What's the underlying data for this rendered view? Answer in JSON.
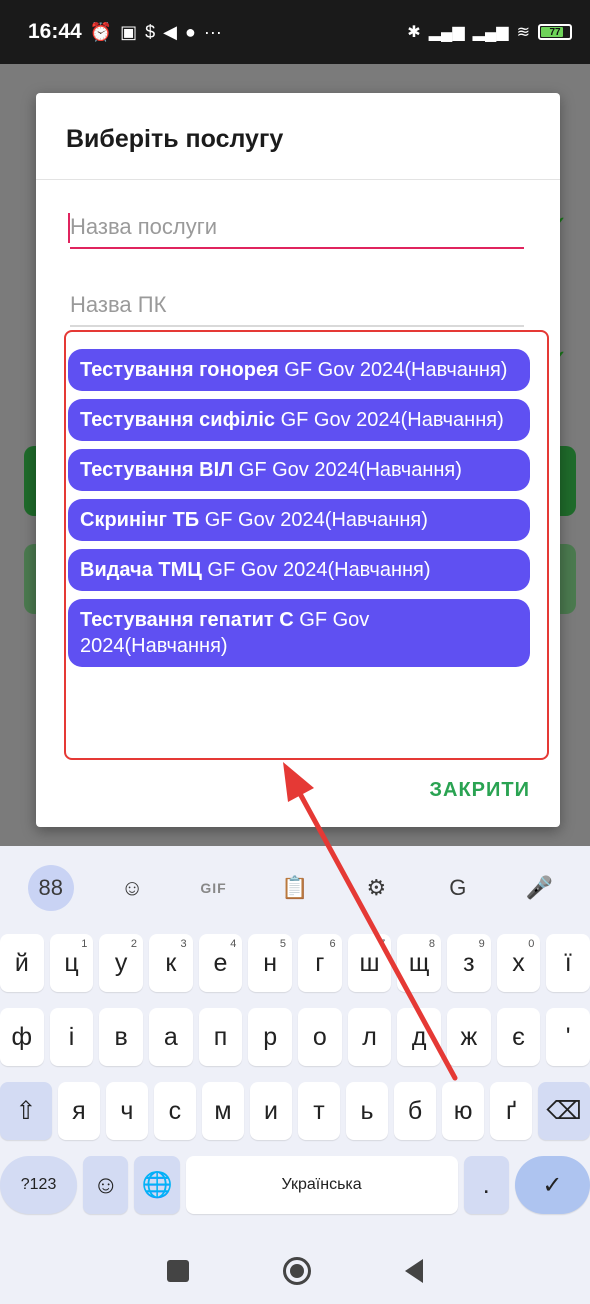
{
  "status_bar": {
    "time": "16:44",
    "left_icons": [
      "⏰",
      "▣",
      "$",
      "◀",
      "●",
      "···"
    ],
    "right_icons": [
      "✱",
      "▂▄▆",
      "▂▄▆",
      "≋"
    ],
    "battery": "77"
  },
  "dialog": {
    "title": "Виберіть послугу",
    "service_field_placeholder": "Назва послуги",
    "pc_field_placeholder": "Назва ПК",
    "services": [
      {
        "bold": "Тестування гонорея",
        "rest": " GF Gov 2024(Навчання)"
      },
      {
        "bold": "Тестування сифіліс",
        "rest": " GF Gov 2024(Навчання)"
      },
      {
        "bold": "Тестування ВІЛ",
        "rest": " GF Gov 2024(Навчання)"
      },
      {
        "bold": "Скринінг ТБ",
        "rest": " GF Gov 2024(Навчання)"
      },
      {
        "bold": "Видача ТМЦ",
        "rest": " GF Gov 2024(Навчання)"
      },
      {
        "bold": "Тестування гепатит С",
        "rest": " GF Gov 2024(Навчання)"
      }
    ],
    "close_label": "ЗАКРИТИ"
  },
  "keyboard": {
    "toolbar": {
      "apps": "88",
      "sticker": "☺",
      "gif": "GIF",
      "clipboard": "📋",
      "settings": "⚙",
      "translate": "G",
      "mic": "🎤"
    },
    "row1": [
      {
        "k": "й",
        "s": ""
      },
      {
        "k": "ц",
        "s": "1"
      },
      {
        "k": "у",
        "s": "2"
      },
      {
        "k": "к",
        "s": "3"
      },
      {
        "k": "е",
        "s": "4"
      },
      {
        "k": "н",
        "s": "5"
      },
      {
        "k": "г",
        "s": "6"
      },
      {
        "k": "ш",
        "s": "7"
      },
      {
        "k": "щ",
        "s": "8"
      },
      {
        "k": "з",
        "s": "9"
      },
      {
        "k": "х",
        "s": "0"
      },
      {
        "k": "ї",
        "s": ""
      }
    ],
    "row2": [
      "ф",
      "і",
      "в",
      "а",
      "п",
      "р",
      "о",
      "л",
      "д",
      "ж",
      "є",
      "'"
    ],
    "row3": [
      "я",
      "ч",
      "с",
      "м",
      "и",
      "т",
      "ь",
      "б",
      "ю",
      "ґ"
    ],
    "shift": "⇧",
    "backspace": "⌫",
    "sym_label": "?123",
    "emoji": "☺",
    "globe": "🌐",
    "space_label": "Українська",
    "period": ".",
    "enter": "✓"
  }
}
